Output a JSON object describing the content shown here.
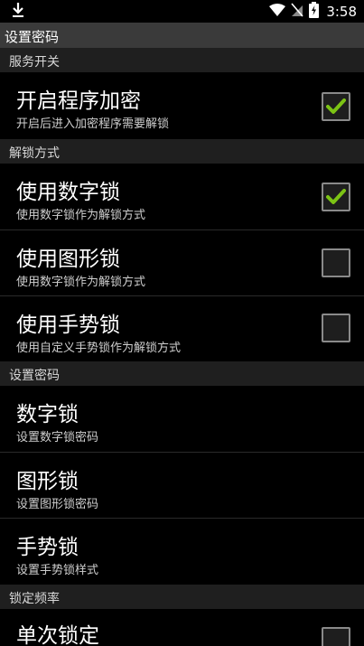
{
  "status_bar": {
    "time": "3:58"
  },
  "title_bar": {
    "title": "设置密码"
  },
  "sections": [
    {
      "label": "服务开关"
    },
    {
      "label": "解锁方式"
    },
    {
      "label": "设置密码"
    },
    {
      "label": "锁定频率"
    }
  ],
  "items": [
    {
      "title": "开启程序加密",
      "subtitle": "开启后进入加密程序需要解锁",
      "checked": true
    },
    {
      "title": "使用数字锁",
      "subtitle": "使用数字锁作为解锁方式",
      "checked": true
    },
    {
      "title": "使用图形锁",
      "subtitle": "使用数字锁作为解锁方式",
      "checked": false
    },
    {
      "title": "使用手势锁",
      "subtitle": "使用自定义手势锁作为解锁方式",
      "checked": false
    },
    {
      "title": "数字锁",
      "subtitle": "设置数字锁密码"
    },
    {
      "title": "图形锁",
      "subtitle": "设置图形锁密码"
    },
    {
      "title": "手势锁",
      "subtitle": "设置手势锁样式"
    },
    {
      "title": "单次锁定",
      "checked": false
    }
  ],
  "colors": {
    "check_accent": "#7cc314",
    "section_bg": "#1f1f1f",
    "title_bar_bg": "#3a3a3a"
  }
}
